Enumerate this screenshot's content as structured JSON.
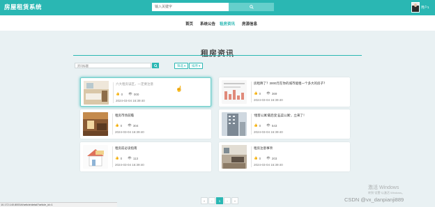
{
  "app": {
    "title": "房屋租赁系统",
    "brand_color": "#2ab7b3"
  },
  "header": {
    "search_placeholder": "输入关键字",
    "search_icon": "search-icon",
    "username": "用户1"
  },
  "nav": {
    "items": [
      {
        "label": "首页",
        "active": false
      },
      {
        "label": "系统公告",
        "active": false
      },
      {
        "label": "租房资讯",
        "active": true
      },
      {
        "label": "房源信息",
        "active": false
      }
    ]
  },
  "page": {
    "title": "租房资讯",
    "filter_placeholder": "资讯标题",
    "filter_dropdown": "筛选",
    "sort_dropdown": "排序"
  },
  "cards": [
    {
      "title": "六大租房误区，一定要注意",
      "likes": "0",
      "views": "000",
      "date": "2024-03-04 16:39:40",
      "image": "furnished room photo"
    },
    {
      "title": "房租降了？3000元在你的城市能租一个多大的房子？",
      "likes": "0",
      "views": "369",
      "date": "2024-03-04 16:39:40",
      "image": "article chart screenshot"
    },
    {
      "title": "租房市场前瞻",
      "likes": "0",
      "views": "304",
      "date": "2024-03-04 16:39:40",
      "image": "warm interior photo"
    },
    {
      "title": "'租客公寓'最后变'韭菜公寓'，立来了！",
      "likes": "0",
      "views": "543",
      "date": "2024-03-04 16:39:40",
      "image": "apartment tower photo"
    },
    {
      "title": "租房前必读指南",
      "likes": "0",
      "views": "113",
      "date": "2024-03-04 16:39:40",
      "image": "house illustration"
    },
    {
      "title": "租房注意事项",
      "likes": "0",
      "views": "203",
      "date": "2024-03-04 16:39:40",
      "image": "living room photo"
    }
  ],
  "pagination": {
    "prev_first": "«",
    "prev": "‹",
    "current": "1",
    "next": "›",
    "next_last": "»"
  },
  "status_url": "10.172.140.8000/#/article/detail?article_id=1",
  "watermark": {
    "line1": "激活 Windows",
    "line2": "转到\"设置\"以激活 Windows。",
    "credit": "CSDN @vx_danpianji889"
  }
}
